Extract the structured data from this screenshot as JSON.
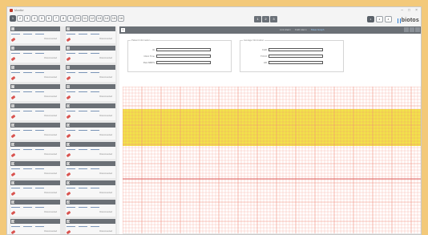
{
  "titlebar": {
    "title": "Monitor"
  },
  "window_controls": [
    "–",
    "□",
    "×"
  ],
  "bed_tabs": [
    "1",
    "2",
    "3",
    "4",
    "5",
    "6",
    "7",
    "8",
    "9",
    "10",
    "11",
    "12",
    "13",
    "14",
    "15",
    "16"
  ],
  "active_bed_tab": "1",
  "center_buttons": [
    "1",
    "2",
    "3"
  ],
  "right_tabs": [
    "1",
    "2",
    "4"
  ],
  "brand": "biotos",
  "sidebar": {
    "card_label": "Disconnected",
    "left_numbers": [
      "1",
      "3",
      "5",
      "7",
      "9",
      "11",
      "13",
      "15",
      "17",
      "19",
      "21"
    ],
    "right_numbers": [
      "2",
      "4",
      "6",
      "8",
      "10",
      "12",
      "14",
      "16",
      "18",
      "20",
      "22"
    ]
  },
  "main": {
    "bed_number": "1",
    "header_links": [
      "Link Alarm",
      "FHR Alarm",
      "Show Graph"
    ],
    "group1": {
      "title": "Patient Information",
      "rows": [
        "ID",
        "Clinic Time",
        "Past MBPS"
      ]
    },
    "group2": {
      "title": "Average Information",
      "rows": [
        "FHR",
        "TOCO",
        "HR"
      ]
    }
  },
  "colors": {
    "accent": "#5a6169",
    "grid": "#f08a7a",
    "band": "#f2e24a",
    "frame": "#f3c97a"
  }
}
